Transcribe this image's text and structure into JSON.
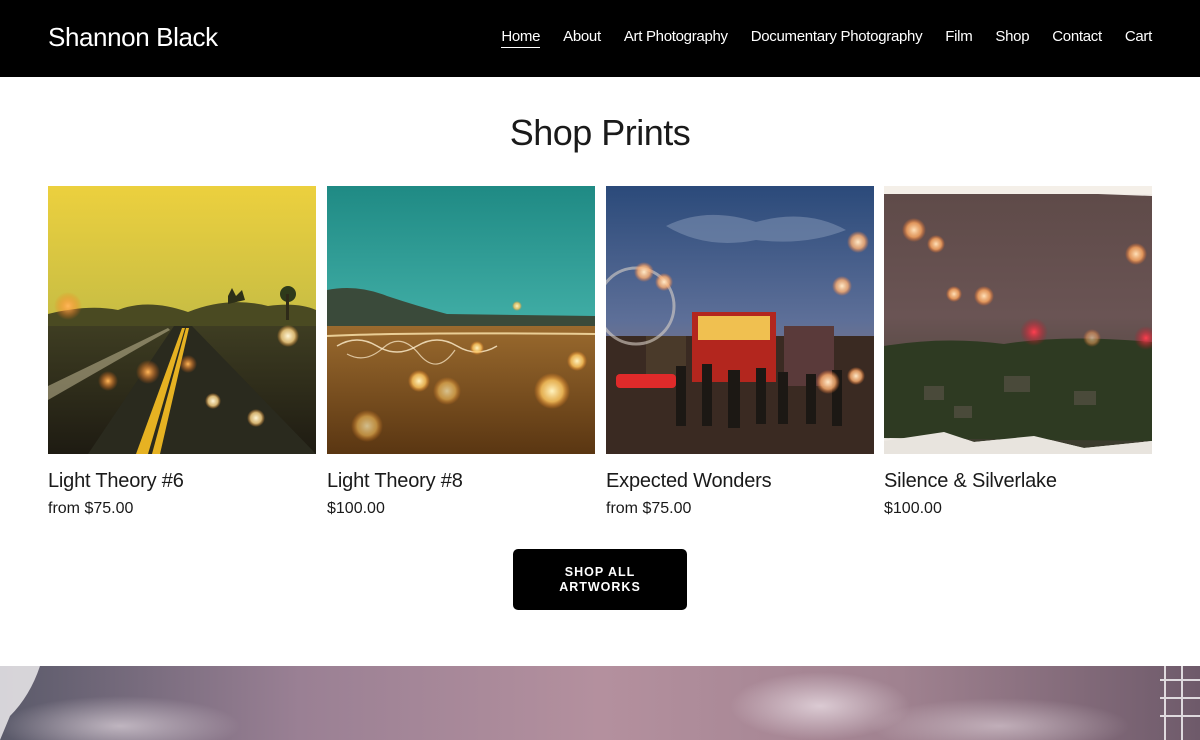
{
  "site": {
    "title": "Shannon Black"
  },
  "nav": {
    "items": [
      {
        "label": "Home",
        "active": true
      },
      {
        "label": "About"
      },
      {
        "label": "Art Photography"
      },
      {
        "label": "Documentary Photography"
      },
      {
        "label": "Film"
      },
      {
        "label": "Shop"
      },
      {
        "label": "Contact"
      },
      {
        "label": "Cart"
      }
    ]
  },
  "shop": {
    "heading": "Shop Prints",
    "products": [
      {
        "title": "Light Theory #6",
        "price": "from $75.00"
      },
      {
        "title": "Light Theory #8",
        "price": "$100.00"
      },
      {
        "title": "Expected Wonders",
        "price": "from $75.00"
      },
      {
        "title": "Silence & Silverlake",
        "price": "$100.00"
      }
    ],
    "cta_label": "SHOP ALL ARTWORKS"
  },
  "colors": {
    "header_bg": "#000000",
    "header_text": "#ffffff",
    "page_bg": "#ffffff",
    "text": "#1a1a1a",
    "button_bg": "#000000",
    "button_text": "#ffffff"
  }
}
